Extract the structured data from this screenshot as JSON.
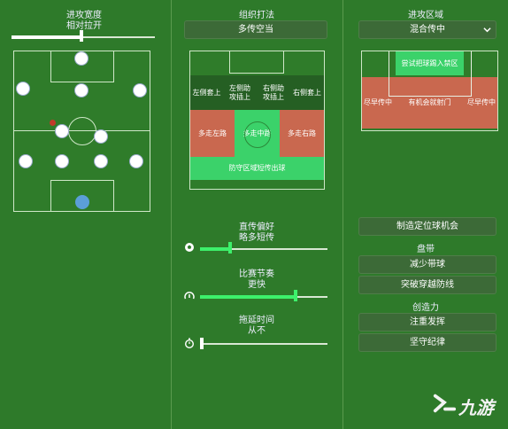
{
  "left": {
    "width_title": "进攻宽度",
    "width_value": "相对拉开",
    "width_level_percent": 48
  },
  "middle": {
    "passing_title": "组织打法",
    "passing_value": "多传空当",
    "zones": {
      "left_wing": "左侧套上",
      "left_fullback": "左侧助\n攻插上",
      "right_fullback": "右侧助\n攻插上",
      "right_wing": "右侧套上",
      "left_flank": "多走左路",
      "center": "多走中路",
      "right_flank": "多走右路",
      "defense": "防守区域短传出球"
    },
    "sliders": [
      {
        "title": "直传偏好",
        "value": "略多短传",
        "icon": "ball-icon",
        "fill_percent": 23
      },
      {
        "title": "比赛节奏",
        "value": "更快",
        "icon": "gauge-icon",
        "fill_percent": 78
      },
      {
        "title": "拖延时间",
        "value": "从不",
        "icon": "stopwatch-icon",
        "fill_percent": 0
      }
    ]
  },
  "right": {
    "zone_title": "进攻区域",
    "zone_value": "混合传中",
    "zones": {
      "top": "尝试把球踢入禁区",
      "left": "尽早传中",
      "center": "有机会就射门",
      "right": "尽早传中"
    },
    "set_piece_btn": "制造定位球机会",
    "dribble_title": "盘带",
    "dribble_btn1": "减少带球",
    "dribble_btn2": "突破穿越防线",
    "creativity_title": "创造力",
    "creativity_btn1": "注重发挥",
    "creativity_btn2": "坚守纪律"
  },
  "watermark": "九游",
  "colors": {
    "background": "#2e7a2a",
    "accent_green": "#3df06b",
    "zone_red": "#c9684f",
    "zone_green": "#3bd26a",
    "keeper_blue": "#5b9fd8"
  }
}
